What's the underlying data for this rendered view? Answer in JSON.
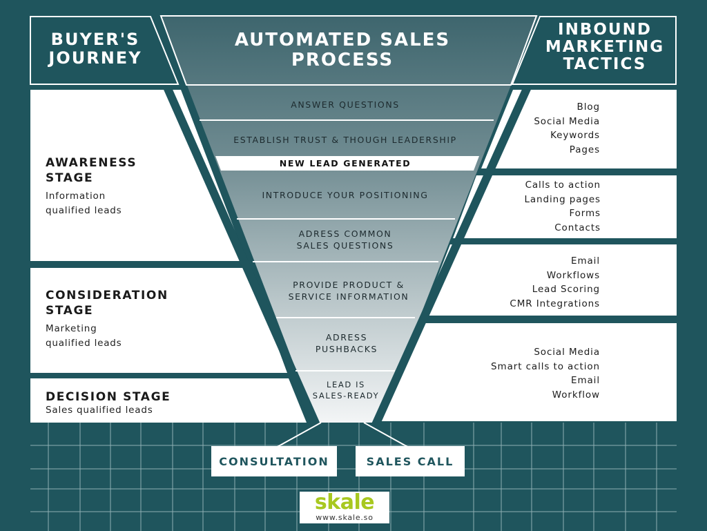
{
  "colors": {
    "background": "#1f555d",
    "panel": "#ffffff",
    "funnel_top": "#426a72",
    "funnel_bottom": "#eef1f2",
    "grid_line": "#8fb0b4",
    "brand_green": "#a8c820"
  },
  "headers": {
    "buyers_journey": [
      "BUYER'S",
      "JOURNEY"
    ],
    "automated_sales_process": [
      "AUTOMATED SALES",
      "PROCESS"
    ],
    "inbound_marketing_tactics": [
      "INBOUND",
      "MARKETING",
      "TACTICS"
    ]
  },
  "stages": [
    {
      "title": [
        "AWARENESS",
        "STAGE"
      ],
      "subtitle": [
        "Information",
        "qualified leads"
      ]
    },
    {
      "title": [
        "CONSIDERATION",
        "STAGE"
      ],
      "subtitle": [
        "Marketing",
        "qualified leads"
      ]
    },
    {
      "title": [
        "DECISION STAGE"
      ],
      "subtitle": [
        "Sales qualified leads"
      ]
    }
  ],
  "funnel_steps": [
    {
      "lines": [
        "ANSWER QUESTIONS"
      ]
    },
    {
      "lines": [
        "ESTABLISH TRUST & THOUGH LEADERSHIP"
      ]
    },
    {
      "lines": [
        "NEW LEAD GENERATED"
      ],
      "highlight": true
    },
    {
      "lines": [
        "INTRODUCE YOUR POSITIONING"
      ]
    },
    {
      "lines": [
        "ADRESS COMMON",
        "SALES QUESTIONS"
      ]
    },
    {
      "lines": [
        "PROVIDE PRODUCT &",
        "SERVICE INFORMATION"
      ]
    },
    {
      "lines": [
        "ADRESS",
        "PUSHBACKS"
      ]
    },
    {
      "lines": [
        "LEAD IS",
        "SALES-READY"
      ]
    }
  ],
  "tactics": [
    {
      "items": [
        "Blog",
        "Social Media",
        "Keywords",
        "Pages"
      ]
    },
    {
      "items": [
        "Calls to action",
        "Landing pages",
        "Forms",
        "Contacts"
      ]
    },
    {
      "items": [
        "Email",
        "Workflows",
        "Lead Scoring",
        "CMR Integrations"
      ]
    },
    {
      "items": [
        "Social Media",
        "Smart calls to action",
        "Email",
        "Workflow"
      ]
    }
  ],
  "outcomes": {
    "consultation": "CONSULTATION",
    "sales_call": "SALES CALL"
  },
  "logo": {
    "wordmark": "skale",
    "url": "www.skale.so"
  }
}
